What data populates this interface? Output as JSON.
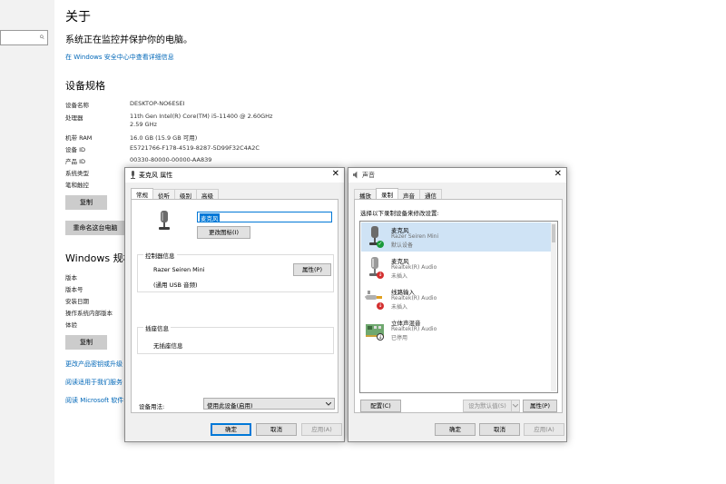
{
  "settings": {
    "search_glyph": "⌕",
    "about_title": "关于",
    "protect_text": "系统正在监控并保护你的电脑。",
    "security_link": "在 Windows 安全中心中查看详细信息",
    "specs_title": "设备规格",
    "specs": [
      {
        "key": "设备名称",
        "value": "DESKTOP-NO6ESEI"
      },
      {
        "key": "处理器",
        "value": "11th Gen Intel(R) Core(TM) i5-11400 @ 2.60GHz"
      },
      {
        "key": "",
        "value": "2.59 GHz"
      },
      {
        "key": "机带 RAM",
        "value": "16.0 GB (15.9 GB 可用)"
      },
      {
        "key": "设备 ID",
        "value": "E5721766-F178-4519-8287-5D99F32C4A2C"
      },
      {
        "key": "产品 ID",
        "value": "00330-80000-00000-AA839"
      },
      {
        "key": "系统类型",
        "value": ""
      },
      {
        "key": "笔和触控",
        "value": ""
      }
    ],
    "copy_label": "复制",
    "rename_label": "重命名这台电脑",
    "win_title": "Windows 规格",
    "win_rows": [
      "版本",
      "版本号",
      "安装日期",
      "操作系统内部版本",
      "体验"
    ],
    "copy2_label": "复制",
    "link_change_key": "更改产品密钥或升级",
    "link_service": "阅读适用于我们服务",
    "link_license": "阅读 Microsoft 软件许"
  },
  "props_dialog": {
    "title": "麦克风 属性",
    "close_glyph": "✕",
    "tabs": [
      "常规",
      "侦听",
      "级别",
      "高级"
    ],
    "name_value": "麦克风",
    "change_icon_label": "更改图标(I)",
    "controller_legend": "控制器信息",
    "controller_name": "Razer Seiren Mini",
    "controller_sub": "(通用 USB 音频)",
    "properties_label": "属性(P)",
    "jack_legend": "插座信息",
    "jack_text": "无插座信息",
    "usage_label": "设备用法:",
    "usage_value": "使用此设备(启用)",
    "ok_label": "确定",
    "cancel_label": "取消",
    "apply_label": "应用(A)"
  },
  "sound_dialog": {
    "title": "声音",
    "close_glyph": "✕",
    "tabs": [
      "播放",
      "录制",
      "声音",
      "通信"
    ],
    "instruction": "选择以下录制设备来修改设置:",
    "devices": [
      {
        "name": "麦克风",
        "driver": "Razer Seiren Mini",
        "status": "默认设备"
      },
      {
        "name": "麦克风",
        "driver": "Realtek(R) Audio",
        "status": "未插入"
      },
      {
        "name": "线路输入",
        "driver": "Realtek(R) Audio",
        "status": "未插入"
      },
      {
        "name": "立体声混音",
        "driver": "Realtek(R) Audio",
        "status": "已停用"
      }
    ],
    "configure_label": "配置(C)",
    "set_default_label": "设为默认值(S)",
    "properties_label": "属性(P)",
    "ok_label": "确定",
    "cancel_label": "取消",
    "apply_label": "应用(A)"
  },
  "colors": {
    "link": "#0067b8",
    "selection": "#cfe3f5",
    "ok_badge": "#1a9a39",
    "error_badge": "#d32f2f"
  }
}
